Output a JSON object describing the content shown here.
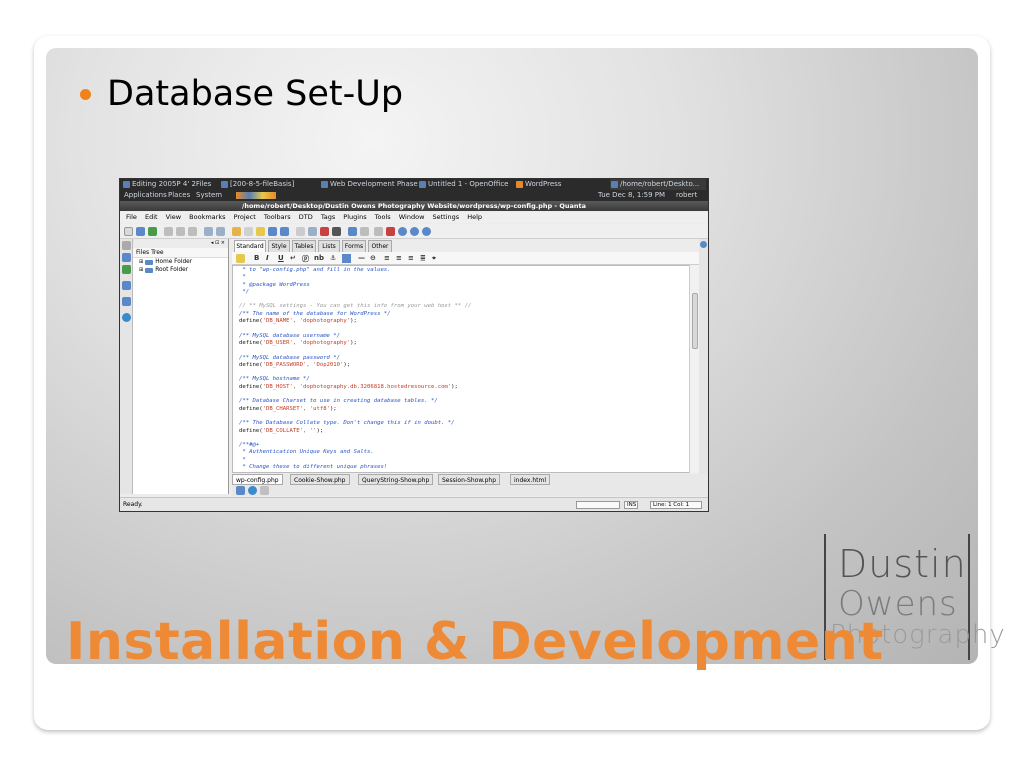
{
  "slide": {
    "bullet": "Database Set-Up",
    "title": "Installation & Development",
    "logo": {
      "line1": "Dustin",
      "line2": "Owens",
      "line3": "Photography"
    },
    "accent_color": "#f0821e"
  },
  "desktop": {
    "top_tasks": [
      "Editing 2005P 4' 2Files",
      "[200-8-5-fileBasis]",
      "Web Development Phase",
      "Untitled 1 - OpenOffice",
      "WordPress",
      "/home/robert/Deskto..."
    ],
    "menu_row": [
      "Applications",
      "Places",
      "System"
    ],
    "clock": "Tue Dec 8, 1:59 PM",
    "user": "robert"
  },
  "window": {
    "title": "/home/robert/Desktop/Dustin Owens Photography Website/wordpress/wp-config.php - Quanta",
    "menu": [
      "File",
      "Edit",
      "View",
      "Bookmarks",
      "Project",
      "Toolbars",
      "DTD",
      "Tags",
      "Plugins",
      "Tools",
      "Window",
      "Settings",
      "Help"
    ]
  },
  "files_panel": {
    "tab_label": "Files Tree",
    "items": [
      "Home Folder",
      "Root Folder"
    ]
  },
  "quick_tabs": [
    "Standard",
    "Style",
    "Tables",
    "Lists",
    "Forms",
    "Other"
  ],
  "quick_tools": [
    "B",
    "I",
    "U",
    "nb"
  ],
  "code_lines": [
    " * to \"wp-config.php\" and fill in the values.",
    " *",
    " * @package WordPress",
    " */",
    "",
    "// ** MySQL settings - You can get this info from your web host ** //",
    "/** The name of the database for WordPress */",
    "define('DB_NAME', 'dophotography');",
    "",
    "/** MySQL database username */",
    "define('DB_USER', 'dophotography');",
    "",
    "/** MySQL database password */",
    "define('DB_PASSWORD', 'Dop2010');",
    "",
    "/** MySQL hostname */",
    "define('DB_HOST', 'dophotography.db.3206818.hostedresource.com');",
    "",
    "/** Database Charset to use in creating database tables. */",
    "define('DB_CHARSET', 'utf8');",
    "",
    "/** The Database Collate type. Don't change this if in doubt. */",
    "define('DB_COLLATE', '');",
    "",
    "/**#@+",
    " * Authentication Unique Keys and Salts.",
    " *",
    " * Change these to different unique phrases!"
  ],
  "doc_tabs": [
    "wp-config.php",
    "Cookie-Show.php",
    "QueryString-Show.php",
    "Session-Show.php",
    "index.html"
  ],
  "status": {
    "left": "Ready.",
    "mode": "INS",
    "position": "Line: 1 Col: 1"
  }
}
